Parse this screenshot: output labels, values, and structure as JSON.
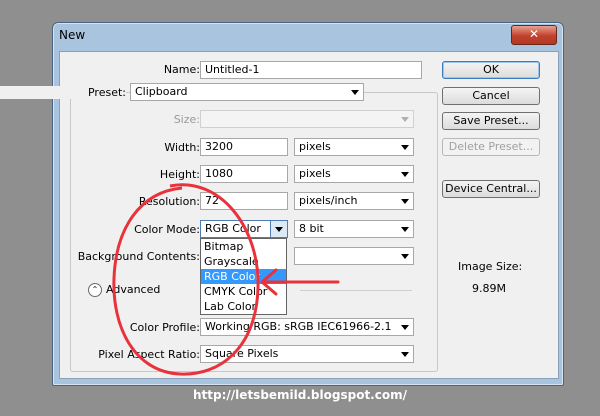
{
  "window": {
    "title": "New",
    "close_icon": "close-icon"
  },
  "form": {
    "name_label": "Name:",
    "name_value": "Untitled-1",
    "preset_label": "Preset:",
    "preset_value": "Clipboard",
    "size_label": "Size:",
    "size_value": "",
    "width_label": "Width:",
    "width_value": "3200",
    "width_unit": "pixels",
    "height_label": "Height:",
    "height_value": "1080",
    "height_unit": "pixels",
    "resolution_label": "Resolution:",
    "resolution_value": "72",
    "resolution_unit": "pixels/inch",
    "color_mode_label": "Color Mode:",
    "color_mode_value": "RGB Color",
    "bit_depth_value": "8 bit",
    "background_label": "Background Contents:",
    "advanced_label": "Advanced",
    "color_profile_label": "Color Profile:",
    "color_profile_value": "Working RGB:  sRGB IEC61966-2.1",
    "pixel_aspect_label": "Pixel Aspect Ratio:",
    "pixel_aspect_value": "Square Pixels"
  },
  "color_mode_options": [
    {
      "label": "Bitmap",
      "selected": false
    },
    {
      "label": "Grayscale",
      "selected": false
    },
    {
      "label": "RGB Color",
      "selected": true
    },
    {
      "label": "CMYK Color",
      "selected": false
    },
    {
      "label": "Lab Color",
      "selected": false
    }
  ],
  "buttons": {
    "ok": "OK",
    "cancel": "Cancel",
    "save_preset": "Save Preset...",
    "delete_preset": "Delete Preset...",
    "device_central": "Device Central..."
  },
  "image_size": {
    "label": "Image Size:",
    "value": "9.89M"
  },
  "watermark": "http://letsbemild.blogspot.com/",
  "colors": {
    "selection": "#3399ff",
    "annotation": "#e8323c",
    "window_frame": "#a9c4df"
  }
}
